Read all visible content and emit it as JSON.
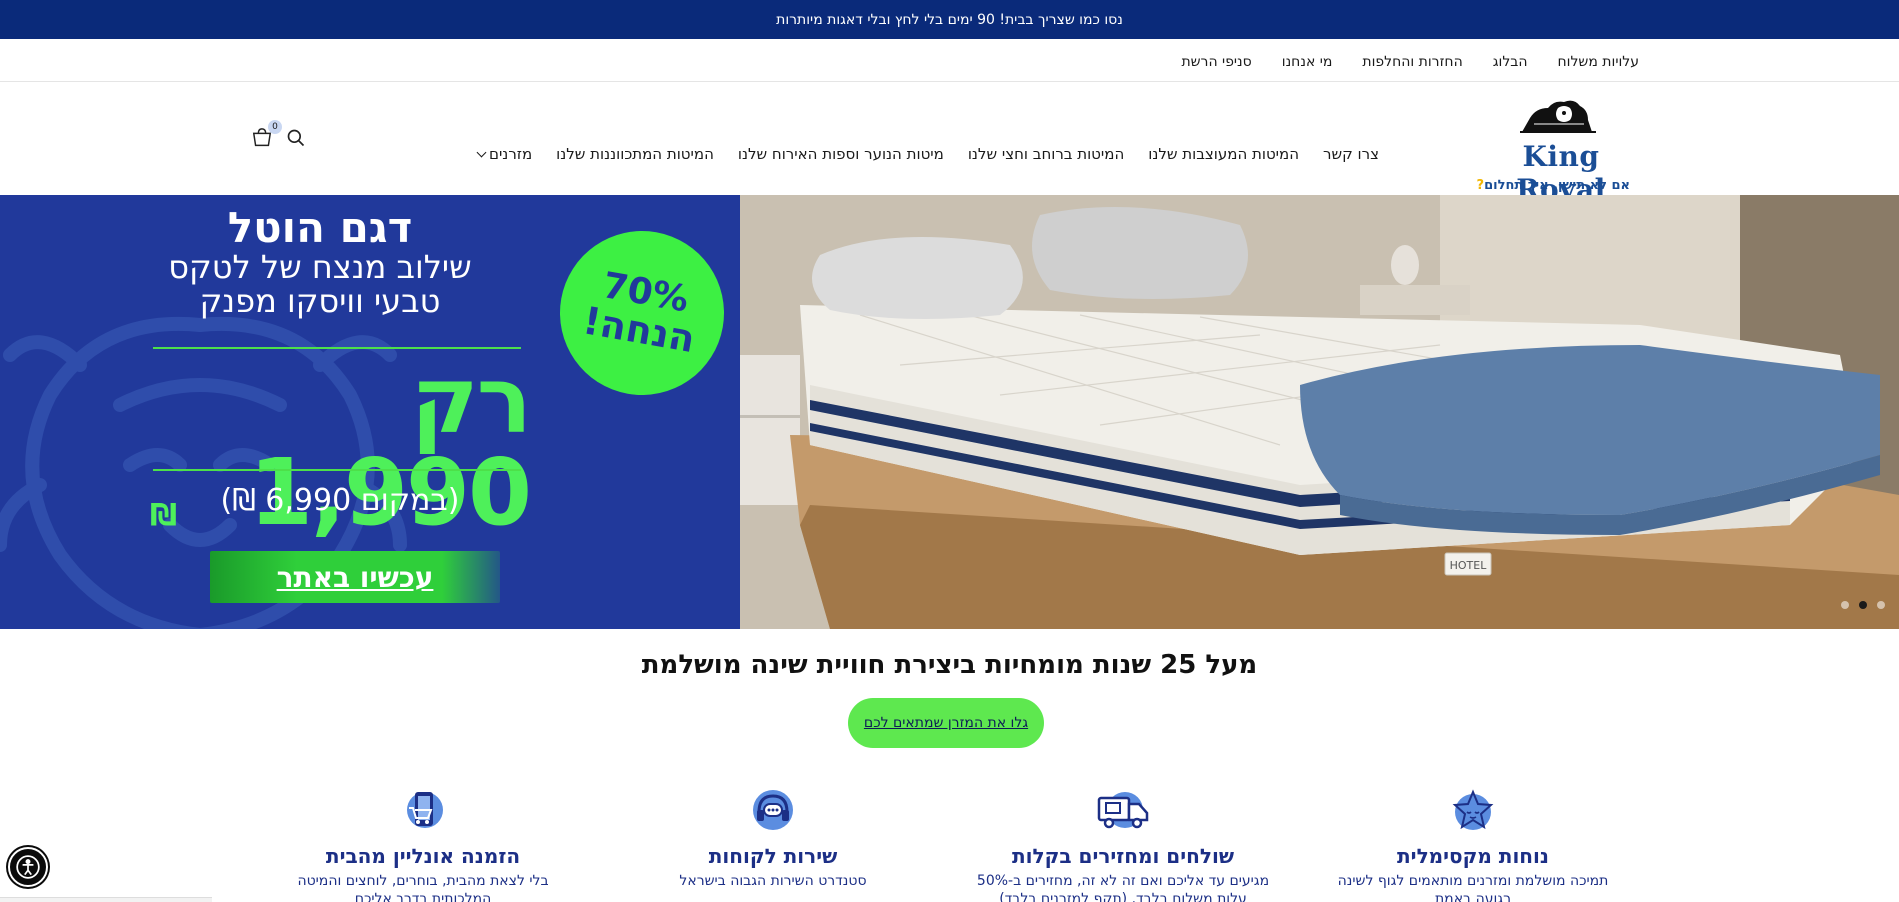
{
  "announcement": "נסו כמו שצריך בבית! 90 ימים בלי לחץ ובלי דאגות מיותרות",
  "top_links": [
    "סניפי הרשת",
    "מי אנחנו",
    "החזרות והחלפות",
    "הבלוג",
    "עלויות משלוח"
  ],
  "logo": {
    "brand": "King Royal",
    "tagline": "אם לא תישן, איך תחלום",
    "tagline_mark": "?"
  },
  "main_nav": [
    "מזרנים",
    "המיטות המתכווננות שלנו",
    "מיטות הנוער וספות האירוח שלנו",
    "המיטות ברוחב וחצי שלנו",
    "המיטות המעוצבות שלנו",
    "צרו קשר"
  ],
  "cart": {
    "count": "0"
  },
  "hero": {
    "title": "דגם הוטל",
    "subtitle_1": "שילוב מנצח של לטקס",
    "subtitle_2": "טבעי וויסקו מפנק",
    "price": "רק 1,990",
    "currency": "₪",
    "old_price": "(במקום 6,990 ₪)",
    "cta": "עכשיו באתר",
    "badge_percent": "70%",
    "badge_text": "הנחה!",
    "bed_label": "HOTEL",
    "slides": 3,
    "active_slide": 2
  },
  "section": {
    "title": "מעל 25 שנות מומחיות ביצירת חוויית שינה מושלמת",
    "cta": "גלו את המזרן שמתאים לכם"
  },
  "features": [
    {
      "icon": "phone-cart-icon",
      "title": "הזמנה אונליין מהבית",
      "desc": "בלי לצאת מהבית, בוחרים, לוחצים והמיטה המלכותית בדרך אליכם"
    },
    {
      "icon": "headset-icon",
      "title": "שירות לקוחות",
      "desc": "סטנדרט השירות הגבוה בישראל"
    },
    {
      "icon": "delivery-truck-icon",
      "title": "שולחים ומחזירים בקלות",
      "desc": "מגיעים עד אליכם ואם זה לא זה, מחזירים ב-50% עלות משלוח בלבד. (תקף למזרנים בלבד)"
    },
    {
      "icon": "sleeping-star-icon",
      "title": "נוחות מקסימלית",
      "desc": "תמיכה מושלמת ומזרנים מותאמים לגוף לשינה רגועה באמת"
    }
  ],
  "colors": {
    "brand_navy": "#0a2a7a",
    "hero_blue": "#21399b",
    "accent_green": "#4ef05a",
    "logo_blue": "#1b4e96",
    "feature_blue": "#1c2f86"
  }
}
